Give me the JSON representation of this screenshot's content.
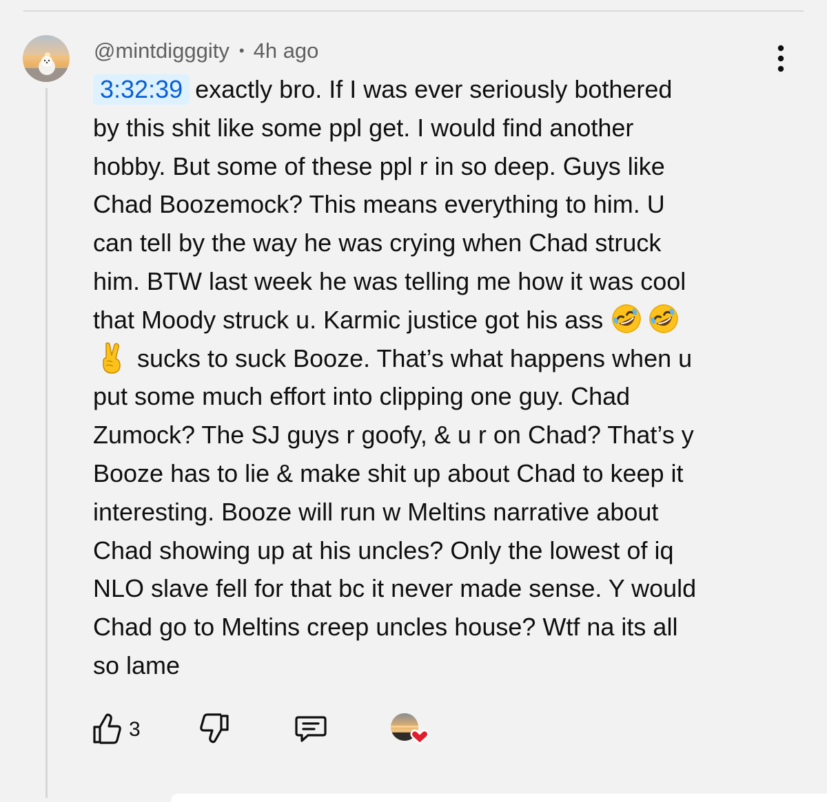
{
  "comment": {
    "author": "@mintdigggity",
    "separator": "•",
    "time_ago": "4h ago",
    "timestamp_link": "3:32:39",
    "body_lines": [
      "exactly bro. If I was ever seriously bothered",
      "by this shit like some ppl get. I would find another",
      "hobby. But some of these ppl r in so deep. Guys like",
      "Chad Boozemock? This means everything to him. U",
      "can tell by the way he was crying when Chad struck",
      "him. BTW last week he was telling me how it was cool",
      "that Moody struck u. Karmic justice got his ass",
      "sucks to suck Booze. That’s what happens when u",
      "put some much effort into clipping one guy. Chad",
      "Zumock? The SJ guys r goofy, & u r on Chad? That’s y",
      "Booze has to lie & make shit up about Chad to keep it",
      "interesting. Booze will run w Meltins narrative about",
      "Chad showing up at his uncles? Only the lowest of iq",
      "NLO slave fell for that bc it never made sense. Y would",
      "Chad go to Meltins creep uncles house? Wtf na its all",
      "so lame"
    ],
    "emojis": {
      "line7_end": [
        "rolling-on-floor-laughing-emoji",
        "rolling-on-floor-laughing-emoji"
      ],
      "line8_start": "victory-hand-emoji"
    }
  },
  "actions": {
    "like_count": "3",
    "like_icon": "thumbs-up-icon",
    "dislike_icon": "thumbs-down-icon",
    "reply_icon": "reply-comment-icon",
    "creator_heart_icon": "creator-heart-icon"
  },
  "menu": {
    "icon": "more-vertical-icon"
  },
  "colors": {
    "background": "#f2f2f2",
    "timestamp_bg": "#def1ff",
    "timestamp_text": "#065fd4",
    "meta_text": "#606060",
    "heart": "#e01e2e"
  }
}
